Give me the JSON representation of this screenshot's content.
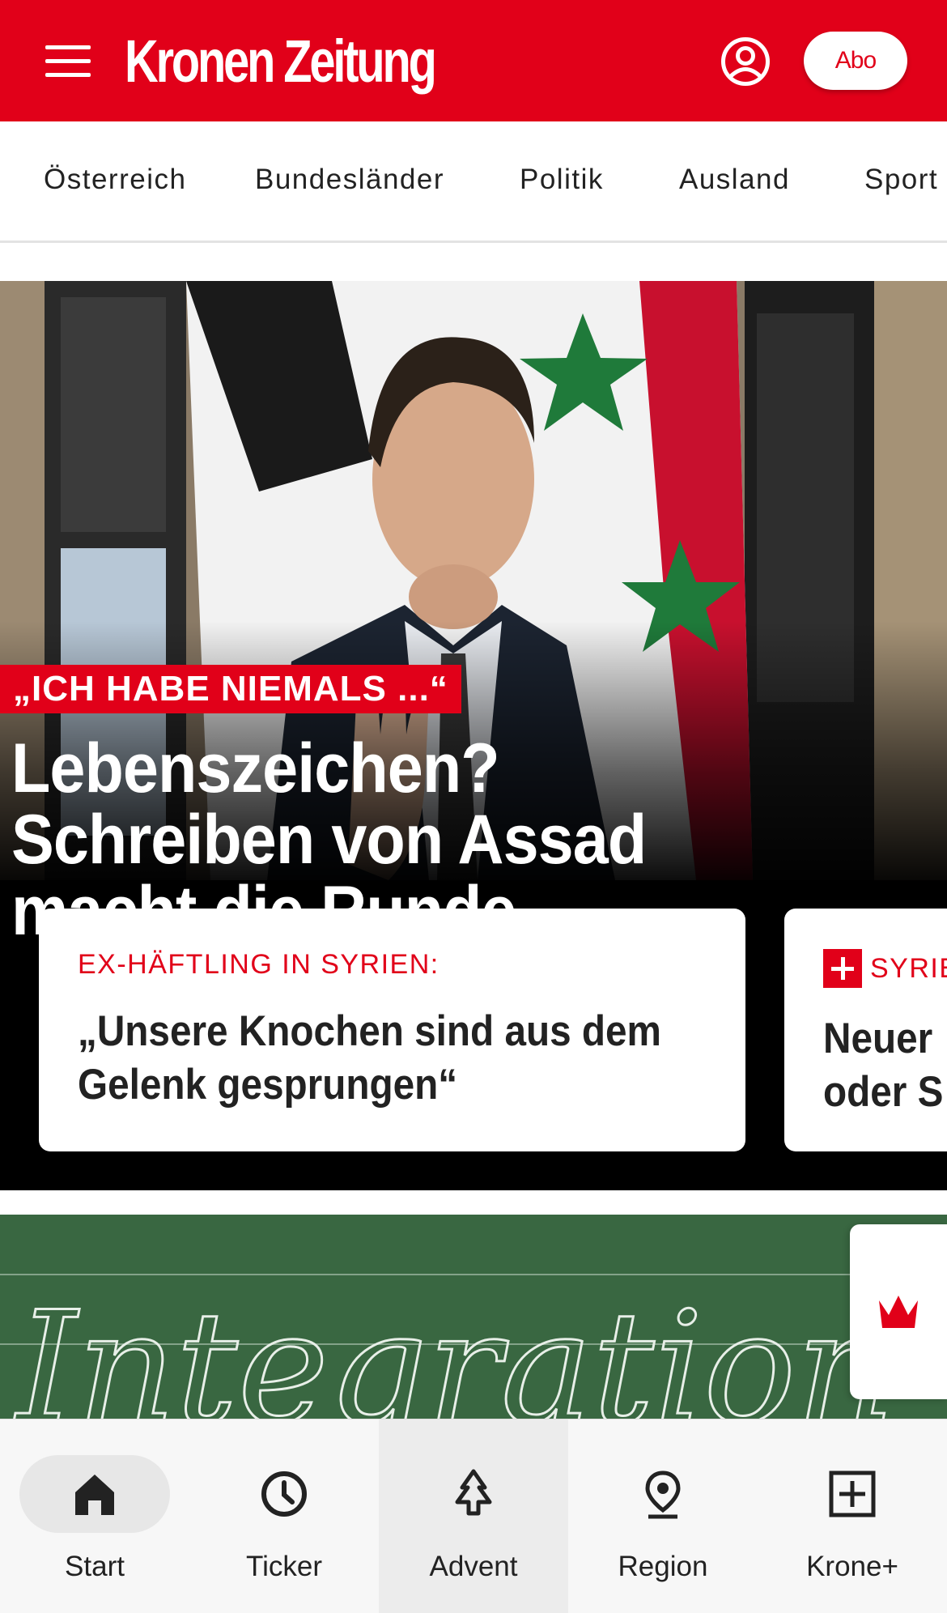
{
  "header": {
    "logo_text": "Kronen Zeitung",
    "abo_label": "Abo",
    "brand_color": "#e10019"
  },
  "nav": {
    "items": [
      "Österreich",
      "Bundesländer",
      "Politik",
      "Ausland",
      "Sport"
    ]
  },
  "hero": {
    "kicker": "„ICH HABE NIEMALS ...“",
    "headline": "Lebenszeichen? Schreiben von Assad macht die Runde",
    "cards": [
      {
        "kicker": "EX-HÄFTLING IN SYRIEN:",
        "title": "„Unsere Knochen sind aus dem Gelenk gesprungen“"
      },
      {
        "kicker": "SYRIE",
        "title": "Neuer oder S"
      }
    ]
  },
  "story2": {
    "chalk_text": "Integration"
  },
  "bottom_nav": {
    "tabs": [
      {
        "label": "Start",
        "icon": "home-icon"
      },
      {
        "label": "Ticker",
        "icon": "clock-icon"
      },
      {
        "label": "Advent",
        "icon": "tree-icon"
      },
      {
        "label": "Region",
        "icon": "location-pin-icon"
      },
      {
        "label": "Krone+",
        "icon": "plus-box-icon"
      }
    ]
  }
}
